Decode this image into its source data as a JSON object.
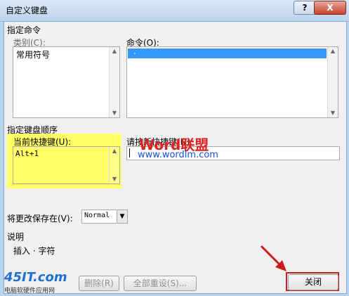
{
  "window": {
    "title": "自定义键盘",
    "help": "?",
    "close": "X"
  },
  "command_group": {
    "title": "指定命令",
    "categories_label": "类别(C):",
    "categories": [
      "常用符号"
    ],
    "commands_label": "命令(O):",
    "commands_selected": "·"
  },
  "keyboard_group": {
    "title": "指定键盘顺序",
    "current_keys_label": "当前快捷键(U):",
    "current_keys": [
      "Alt+1"
    ],
    "new_key_label": "请按新快捷键(N):",
    "new_key_value": ""
  },
  "save_in": {
    "label": "将更改保存在(V):",
    "value": "Normal"
  },
  "description": {
    "title": "说明",
    "text": "插入 · 字符"
  },
  "buttons": {
    "remove": "删除(R)",
    "reset_all": "全部重设(S)...",
    "close": "关闭"
  },
  "watermarks": {
    "brand": "Word联盟",
    "url": "www.wordlm.com",
    "site": "45IT.com",
    "site_sub": "电脑软硬件应用网"
  },
  "colors": {
    "highlight": "#ffff66",
    "arrow": "#cc1b1b",
    "selection": "#3399ff"
  }
}
